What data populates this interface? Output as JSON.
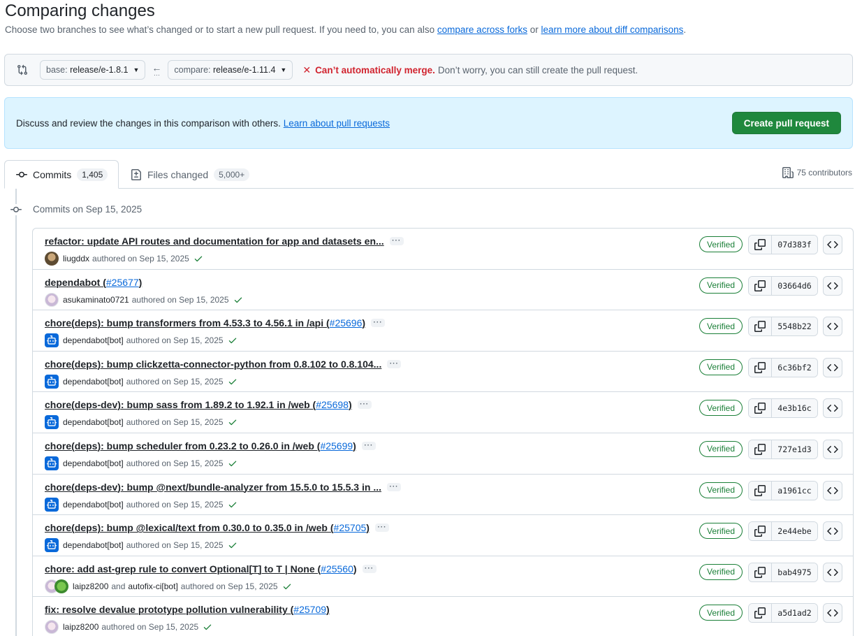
{
  "header": {
    "title": "Comparing changes",
    "subtitle_text": "Choose two branches to see what’s changed or to start a new pull request. If you need to, you can also",
    "link_forks": "compare across forks",
    "or_text": "or",
    "link_learn": "learn more about diff comparisons",
    "period": "."
  },
  "range": {
    "base_prefix": "base:",
    "base_value": "release/e-1.8.1",
    "compare_prefix": "compare:",
    "compare_value": "release/e-1.11.4",
    "merge_title": "Can’t automatically merge.",
    "merge_message": "Don’t worry, you can still create the pull request."
  },
  "discuss": {
    "text": "Discuss and review the changes in this comparison with others.",
    "link": "Learn about pull requests",
    "button": "Create pull request"
  },
  "tabs": {
    "commits_label": "Commits",
    "commits_count": "1,405",
    "files_label": "Files changed",
    "files_count": "5,000+",
    "contributors": "75 contributors"
  },
  "timeline": {
    "date_label": "Commits on Sep 15, 2025"
  },
  "commits": [
    {
      "message": "refactor: update API routes and documentation for app and datasets en...",
      "pr": "",
      "author": "liugddx",
      "coauthor": "",
      "date": "authored on Sep 15, 2025",
      "verified": "Verified",
      "sha": "07d383f",
      "avatar": "photo"
    },
    {
      "message": "dependabot (",
      "pr": "#25677",
      "close": ")",
      "author": "asukaminato0721",
      "coauthor": "",
      "date": "authored on Sep 15, 2025",
      "verified": "Verified",
      "sha": "03664d6",
      "avatar": "anime"
    },
    {
      "message": "chore(deps): bump transformers from 4.53.3 to 4.56.1 in /api (",
      "pr": "#25696",
      "close": ")",
      "author": "dependabot[bot]",
      "coauthor": "",
      "date": "authored on Sep 15, 2025",
      "verified": "Verified",
      "sha": "5548b22",
      "avatar": "bot"
    },
    {
      "message": "chore(deps): bump clickzetta-connector-python from 0.8.102 to 0.8.104...",
      "pr": "",
      "author": "dependabot[bot]",
      "coauthor": "",
      "date": "authored on Sep 15, 2025",
      "verified": "Verified",
      "sha": "6c36bf2",
      "avatar": "bot"
    },
    {
      "message": "chore(deps-dev): bump sass from 1.89.2 to 1.92.1 in /web (",
      "pr": "#25698",
      "close": ")",
      "author": "dependabot[bot]",
      "coauthor": "",
      "date": "authored on Sep 15, 2025",
      "verified": "Verified",
      "sha": "4e3b16c",
      "avatar": "bot"
    },
    {
      "message": "chore(deps): bump scheduler from 0.23.2 to 0.26.0 in /web (",
      "pr": "#25699",
      "close": ")",
      "author": "dependabot[bot]",
      "coauthor": "",
      "date": "authored on Sep 15, 2025",
      "verified": "Verified",
      "sha": "727e1d3",
      "avatar": "bot"
    },
    {
      "message": "chore(deps-dev): bump @next/bundle-analyzer from 15.5.0 to 15.5.3 in ...",
      "pr": "",
      "author": "dependabot[bot]",
      "coauthor": "",
      "date": "authored on Sep 15, 2025",
      "verified": "Verified",
      "sha": "a1961cc",
      "avatar": "bot"
    },
    {
      "message": "chore(deps): bump @lexical/text from 0.30.0 to 0.35.0 in /web (",
      "pr": "#25705",
      "close": ")",
      "author": "dependabot[bot]",
      "coauthor": "",
      "date": "authored on Sep 15, 2025",
      "verified": "Verified",
      "sha": "2e44ebe",
      "avatar": "bot"
    },
    {
      "message": "chore: add ast-grep rule to convert Optional[T] to T | None (",
      "pr": "#25560",
      "close": ")",
      "author": "laipz8200",
      "and_text": "and",
      "coauthor": "autofix-ci[bot]",
      "date": "authored on Sep 15, 2025",
      "verified": "Verified",
      "sha": "bab4975",
      "avatar": "anime2"
    },
    {
      "message": "fix: resolve devalue prototype pollution vulnerability (",
      "pr": "#25709",
      "close": ")",
      "author": "laipz8200",
      "coauthor": "",
      "date": "authored on Sep 15, 2025",
      "verified": "Verified",
      "sha": "a5d1ad2",
      "avatar": "anime"
    }
  ]
}
